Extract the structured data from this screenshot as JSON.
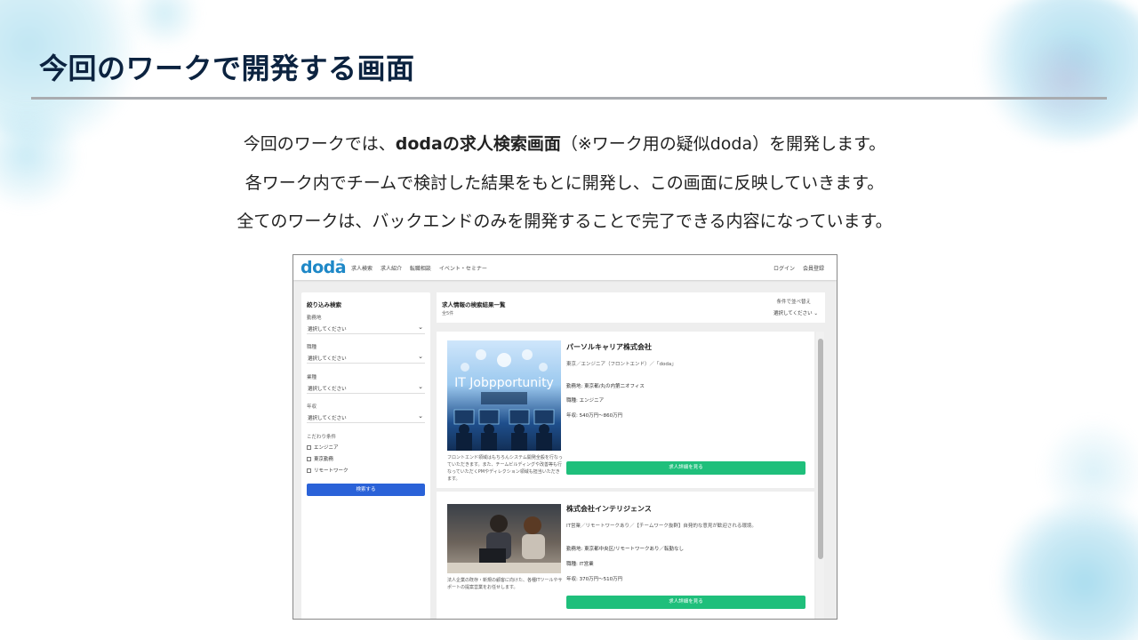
{
  "slide": {
    "title": "今回のワークで開発する画面",
    "line1_pre": "今回のワークでは、",
    "line1_bold": "dodaの求人検索画面",
    "line1_post": "（※ワーク用の疑似doda）を開発します。",
    "line2": "各ワーク内でチームで検討した結果をもとに開発し、この画面に反映していきます。",
    "line3": "全てのワークは、バックエンドのみを開発することで完了できる内容になっています。"
  },
  "app": {
    "logo": "doda",
    "nav": [
      "求人検索",
      "求人紹介",
      "転職相談",
      "イベント・セミナー"
    ],
    "auth": [
      "ログイン",
      "会員登録"
    ],
    "filter": {
      "title": "絞り込み検索",
      "fields": [
        {
          "label": "勤務地",
          "value": "選択してください"
        },
        {
          "label": "職種",
          "value": "選択してください"
        },
        {
          "label": "業種",
          "value": "選択してください"
        },
        {
          "label": "年収",
          "value": "選択してください"
        }
      ],
      "conditions_label": "こだわり条件",
      "checkboxes": [
        "エンジニア",
        "東京勤務",
        "リモートワーク"
      ],
      "search_button": "検索する"
    },
    "results": {
      "title": "求人情報の検索結果一覧",
      "count": "全5件",
      "sort_label": "条件で並べ替え",
      "sort_value": "選択してください"
    },
    "jobs": [
      {
        "company": "パーソルキャリア株式会社",
        "tags": "東京／エンジニア（フロントエンド）／「doda」",
        "location": "勤務地: 東京都/丸の内第二オフィス",
        "role": "職種: エンジニア",
        "salary": "年収: 540万円〜860万円",
        "description": "フロントエンド領域はもちろんシステム開発全般を行なっていただきます。また、チームビルディングや改善等も行なっていただくPMやディレクション領域も担当いただきます。",
        "image_text": "IT Jobpportunity",
        "detail_button": "求人詳細を見る"
      },
      {
        "company": "株式会社インテリジェンス",
        "tags": "IT営業／リモートワークあり／【チームワーク抜群】自発的な意見が歓迎される環境。",
        "location": "勤務地: 東京都中央区/リモートワークあり／転勤なし",
        "role": "職種: IT営業",
        "salary": "年収: 370万円〜510万円",
        "description": "法人企業の既存・新規の顧客に向けた、各種ITツールやサポートの提案営業をお任せします。",
        "detail_button": "求人詳細を見る"
      }
    ]
  }
}
